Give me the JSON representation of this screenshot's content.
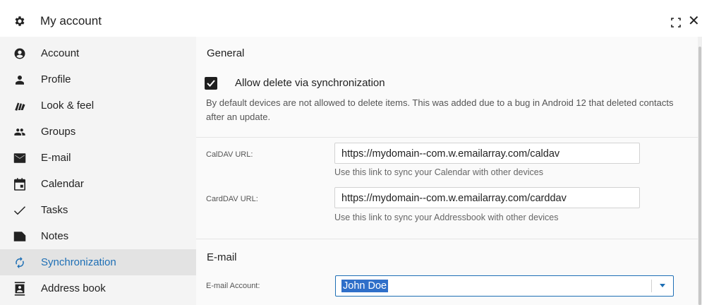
{
  "window": {
    "title": "My account",
    "icons": {
      "settings": "gear-icon",
      "expand": "expand-icon",
      "close": "close-icon"
    },
    "close_glyph": "✕"
  },
  "sidebar": {
    "items": [
      {
        "label": "Account",
        "icon": "account-circle-icon",
        "active": false
      },
      {
        "label": "Profile",
        "icon": "person-icon",
        "active": false
      },
      {
        "label": "Look & feel",
        "icon": "palette-icon",
        "active": false
      },
      {
        "label": "Groups",
        "icon": "group-icon",
        "active": false
      },
      {
        "label": "E-mail",
        "icon": "mail-icon",
        "active": false
      },
      {
        "label": "Calendar",
        "icon": "calendar-icon",
        "active": false
      },
      {
        "label": "Tasks",
        "icon": "check-icon",
        "active": false
      },
      {
        "label": "Notes",
        "icon": "note-icon",
        "active": false
      },
      {
        "label": "Synchronization",
        "icon": "sync-icon",
        "active": true
      },
      {
        "label": "Address book",
        "icon": "address-book-icon",
        "active": false
      }
    ]
  },
  "general": {
    "title": "General",
    "allow_delete": {
      "label": "Allow delete via synchronization",
      "checked": true
    },
    "description": "By default devices are not allowed to delete items. This was added due to a bug in Android 12 that deleted contacts after an update.",
    "caldav": {
      "label": "CalDAV URL:",
      "value": "https://mydomain--com.w.emailarray.com/caldav",
      "hint": "Use this link to sync your Calendar with other devices"
    },
    "carddav": {
      "label": "CardDAV URL:",
      "value": "https://mydomain--com.w.emailarray.com/carddav",
      "hint": "Use this link to sync your Addressbook with other devices"
    }
  },
  "email": {
    "title": "E-mail",
    "account": {
      "label": "E-mail Account:",
      "value": "John Doe"
    }
  },
  "colors": {
    "accent": "#1e6fb5",
    "sidebar_bg": "#f4f4f4",
    "active_bg": "#e3e3e3",
    "selection": "#2f6fc9"
  }
}
